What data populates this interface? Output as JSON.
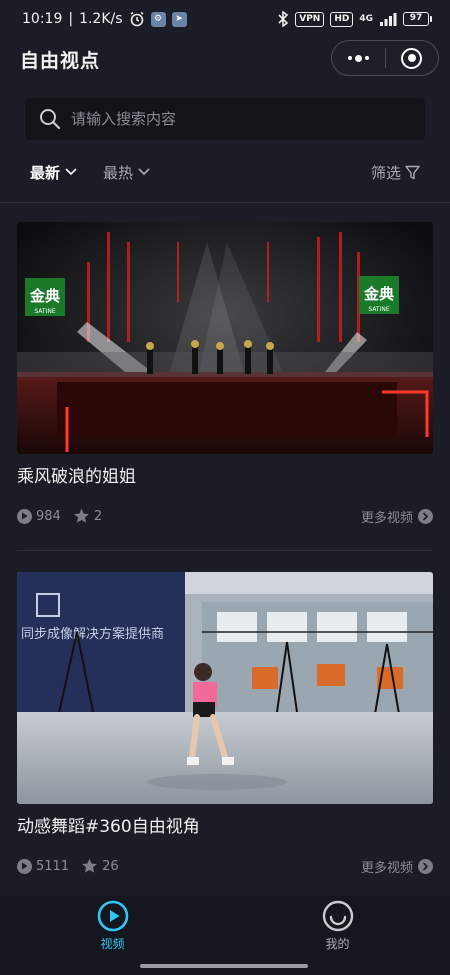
{
  "status_bar": {
    "time": "10:19",
    "speed": "1.2K/s",
    "vpn": "VPN",
    "hd": "HD",
    "network": "4G",
    "battery": "97"
  },
  "header": {
    "title": "自由视点"
  },
  "search": {
    "placeholder": "请输入搜索内容"
  },
  "filters": {
    "sort_tabs": [
      {
        "label": "最新",
        "active": true
      },
      {
        "label": "最热",
        "active": false
      }
    ],
    "filter_label": "筛选"
  },
  "videos": [
    {
      "title": "乘风破浪的姐姐",
      "views": "984",
      "stars": "2",
      "more_label": "更多视频",
      "thumbnail": "stage-dance-performance",
      "banner_text": "金典",
      "banner_sub": "SATINE"
    },
    {
      "title": "动感舞蹈#360自由视角",
      "views": "5111",
      "stars": "26",
      "more_label": "更多视频",
      "thumbnail": "studio-dancer",
      "banner_text": "同步成像解决方案提供商"
    }
  ],
  "tab_bar": {
    "items": [
      {
        "label": "视频",
        "icon": "play-circle-icon",
        "active": true
      },
      {
        "label": "我的",
        "icon": "smile-circle-icon",
        "active": false
      }
    ]
  },
  "colors": {
    "background": "#1b1d26",
    "accent": "#33c6f4",
    "search_bg": "#121419"
  }
}
